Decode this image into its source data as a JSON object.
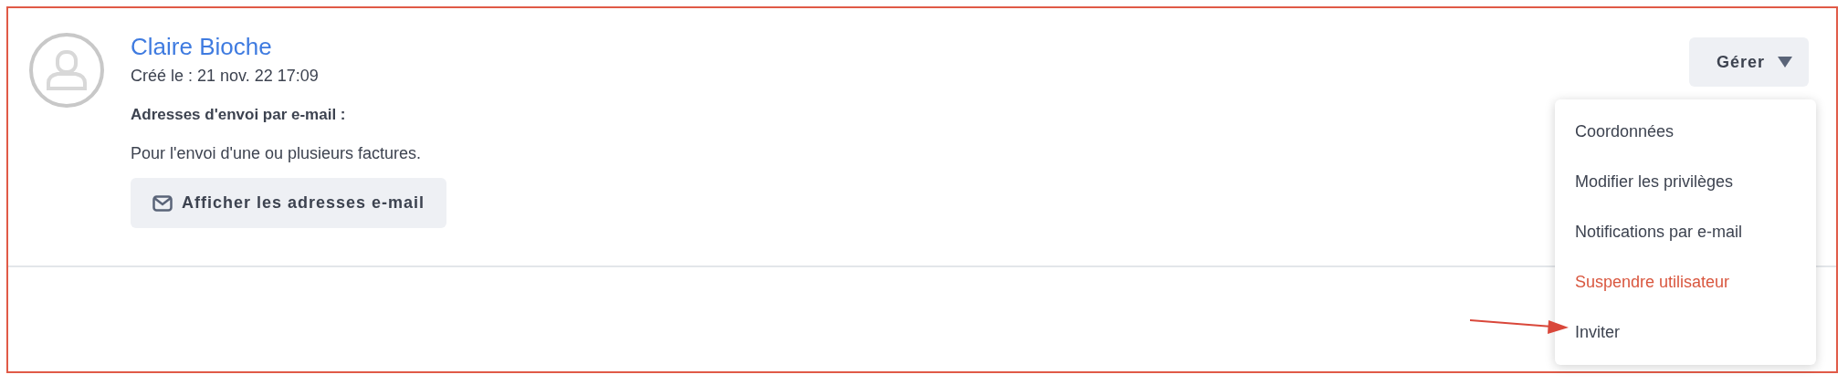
{
  "user": {
    "name": "Claire Bioche",
    "created": "Créé le : 21 nov. 22 17:09",
    "section_title": "Adresses d'envoi par e-mail :",
    "description": "Pour l'envoi d'une ou plusieurs factures.",
    "show_button": "Afficher les adresses e-mail"
  },
  "manage_button": {
    "label": "Gérer",
    "expanded": true
  },
  "menu": [
    {
      "label": "Coordonnées",
      "kind": "normal"
    },
    {
      "label": "Modifier les privilèges",
      "kind": "normal"
    },
    {
      "label": "Notifications par e-mail",
      "kind": "normal"
    },
    {
      "label": "Suspendre utilisateur",
      "kind": "danger"
    },
    {
      "label": "Inviter",
      "kind": "normal"
    }
  ]
}
